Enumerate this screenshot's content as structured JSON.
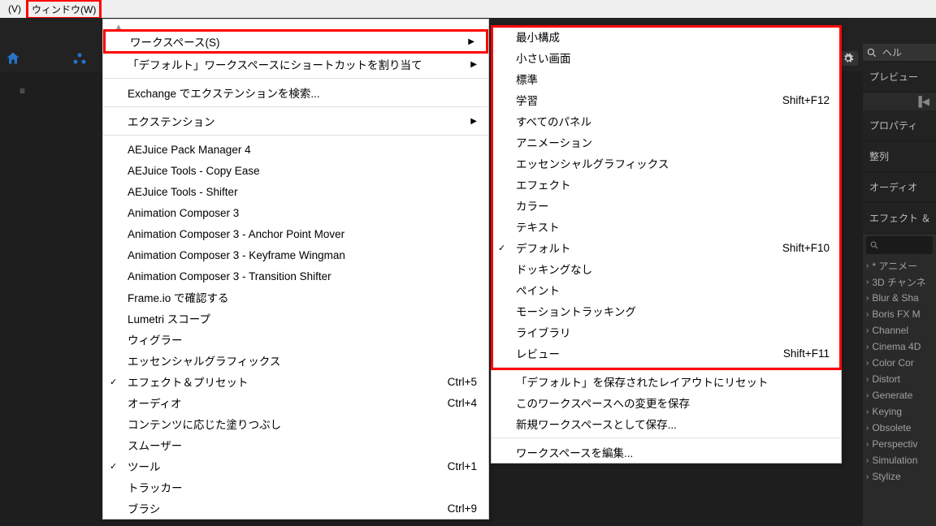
{
  "menubar": {
    "item_v": "(V)",
    "item_window": "ウィンドウ(W)"
  },
  "menu1": {
    "workspace": "ワークスペース(S)",
    "assign_shortcut": "「デフォルト」ワークスペースにショートカットを割り当て",
    "exchange_search": "Exchange でエクステンションを検索...",
    "extension": "エクステンション",
    "aejuice_pack": "AEJuice Pack Manager 4",
    "aejuice_copy": "AEJuice Tools - Copy Ease",
    "aejuice_shifter": "AEJuice Tools - Shifter",
    "ac3": "Animation Composer 3",
    "ac3_anchor": "Animation Composer 3 - Anchor Point Mover",
    "ac3_keyframe": "Animation Composer 3 - Keyframe Wingman",
    "ac3_transition": "Animation Composer 3 - Transition Shifter",
    "frameio": "Frame.io で確認する",
    "lumetri": "Lumetri スコープ",
    "wiggler": "ウィグラー",
    "essential_gfx": "エッセンシャルグラフィックス",
    "effects_presets": "エフェクト＆プリセット",
    "effects_presets_sc": "Ctrl+5",
    "audio": "オーディオ",
    "audio_sc": "Ctrl+4",
    "content_fill": "コンテンツに応じた塗りつぶし",
    "smoother": "スムーザー",
    "tool": "ツール",
    "tool_sc": "Ctrl+1",
    "tracker": "トラッカー",
    "brush": "ブラシ",
    "brush_sc": "Ctrl+9"
  },
  "menu2": {
    "min": "最小構成",
    "small_screen": "小さい画面",
    "standard": "標準",
    "learn": "学習",
    "learn_sc": "Shift+F12",
    "all_panels": "すべてのパネル",
    "animation": "アニメーション",
    "essential_gfx": "エッセンシャルグラフィックス",
    "effects": "エフェクト",
    "color": "カラー",
    "text": "テキスト",
    "default": "デフォルト",
    "default_sc": "Shift+F10",
    "no_docking": "ドッキングなし",
    "paint": "ペイント",
    "motion_tracking": "モーショントラッキング",
    "library": "ライブラリ",
    "review": "レビュー",
    "review_sc": "Shift+F11",
    "reset_layout": "「デフォルト」を保存されたレイアウトにリセット",
    "save_changes": "このワークスペースへの変更を保存",
    "save_as_new": "新規ワークスペースとして保存...",
    "edit_ws": "ワークスペースを編集..."
  },
  "right": {
    "search_label": "ヘル",
    "preview": "プレビュー",
    "property": "プロパティ",
    "align": "整列",
    "audio": "オーディオ",
    "effect_and": "エフェクト ＆",
    "items": [
      "* アニメー",
      "3D チャンネ",
      "Blur & Sha",
      "Boris FX M",
      "Channel",
      "Cinema 4D",
      "Color Cor",
      "Distort",
      "Generate",
      "Keying",
      "Obsolete",
      "Perspectiv",
      "Simulation",
      "Stylize"
    ]
  },
  "misc": {
    "list_icon": "≡"
  }
}
